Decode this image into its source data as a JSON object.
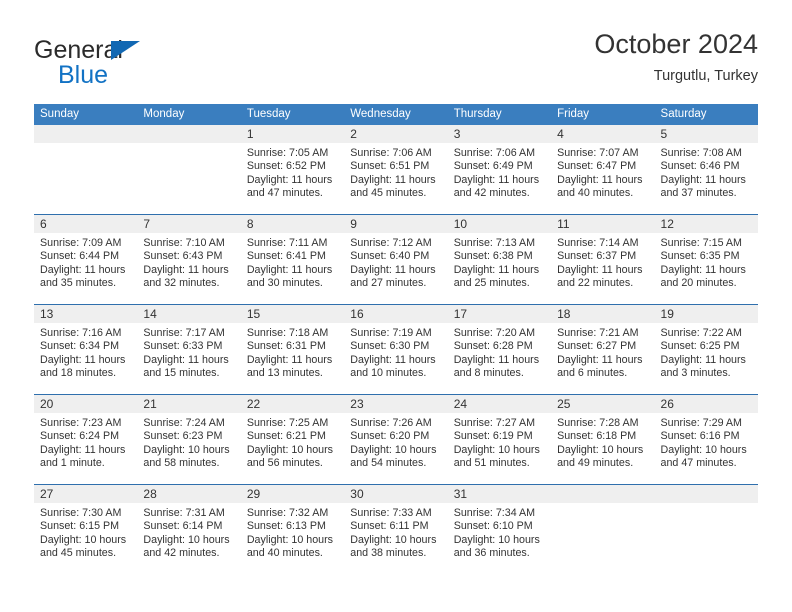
{
  "brand": {
    "name_top": "General",
    "name_bottom": "Blue"
  },
  "header": {
    "title": "October 2024",
    "subtitle": "Turgutlu, Turkey"
  },
  "colors": {
    "header_blue": "#3a7ebf",
    "divider_blue": "#2f6fad",
    "daynum_gray": "#efefef",
    "logo_blue": "#1272c4",
    "text": "#333333"
  },
  "calendar": {
    "weekday_headers": [
      "Sunday",
      "Monday",
      "Tuesday",
      "Wednesday",
      "Thursday",
      "Friday",
      "Saturday"
    ],
    "weeks": [
      [
        {
          "day": "",
          "sunrise": "",
          "sunset": "",
          "daylight": "",
          "empty": true
        },
        {
          "day": "",
          "sunrise": "",
          "sunset": "",
          "daylight": "",
          "empty": true
        },
        {
          "day": "1",
          "sunrise": "Sunrise: 7:05 AM",
          "sunset": "Sunset: 6:52 PM",
          "daylight": "Daylight: 11 hours and 47 minutes."
        },
        {
          "day": "2",
          "sunrise": "Sunrise: 7:06 AM",
          "sunset": "Sunset: 6:51 PM",
          "daylight": "Daylight: 11 hours and 45 minutes."
        },
        {
          "day": "3",
          "sunrise": "Sunrise: 7:06 AM",
          "sunset": "Sunset: 6:49 PM",
          "daylight": "Daylight: 11 hours and 42 minutes."
        },
        {
          "day": "4",
          "sunrise": "Sunrise: 7:07 AM",
          "sunset": "Sunset: 6:47 PM",
          "daylight": "Daylight: 11 hours and 40 minutes."
        },
        {
          "day": "5",
          "sunrise": "Sunrise: 7:08 AM",
          "sunset": "Sunset: 6:46 PM",
          "daylight": "Daylight: 11 hours and 37 minutes."
        }
      ],
      [
        {
          "day": "6",
          "sunrise": "Sunrise: 7:09 AM",
          "sunset": "Sunset: 6:44 PM",
          "daylight": "Daylight: 11 hours and 35 minutes."
        },
        {
          "day": "7",
          "sunrise": "Sunrise: 7:10 AM",
          "sunset": "Sunset: 6:43 PM",
          "daylight": "Daylight: 11 hours and 32 minutes."
        },
        {
          "day": "8",
          "sunrise": "Sunrise: 7:11 AM",
          "sunset": "Sunset: 6:41 PM",
          "daylight": "Daylight: 11 hours and 30 minutes."
        },
        {
          "day": "9",
          "sunrise": "Sunrise: 7:12 AM",
          "sunset": "Sunset: 6:40 PM",
          "daylight": "Daylight: 11 hours and 27 minutes."
        },
        {
          "day": "10",
          "sunrise": "Sunrise: 7:13 AM",
          "sunset": "Sunset: 6:38 PM",
          "daylight": "Daylight: 11 hours and 25 minutes."
        },
        {
          "day": "11",
          "sunrise": "Sunrise: 7:14 AM",
          "sunset": "Sunset: 6:37 PM",
          "daylight": "Daylight: 11 hours and 22 minutes."
        },
        {
          "day": "12",
          "sunrise": "Sunrise: 7:15 AM",
          "sunset": "Sunset: 6:35 PM",
          "daylight": "Daylight: 11 hours and 20 minutes."
        }
      ],
      [
        {
          "day": "13",
          "sunrise": "Sunrise: 7:16 AM",
          "sunset": "Sunset: 6:34 PM",
          "daylight": "Daylight: 11 hours and 18 minutes."
        },
        {
          "day": "14",
          "sunrise": "Sunrise: 7:17 AM",
          "sunset": "Sunset: 6:33 PM",
          "daylight": "Daylight: 11 hours and 15 minutes."
        },
        {
          "day": "15",
          "sunrise": "Sunrise: 7:18 AM",
          "sunset": "Sunset: 6:31 PM",
          "daylight": "Daylight: 11 hours and 13 minutes."
        },
        {
          "day": "16",
          "sunrise": "Sunrise: 7:19 AM",
          "sunset": "Sunset: 6:30 PM",
          "daylight": "Daylight: 11 hours and 10 minutes."
        },
        {
          "day": "17",
          "sunrise": "Sunrise: 7:20 AM",
          "sunset": "Sunset: 6:28 PM",
          "daylight": "Daylight: 11 hours and 8 minutes."
        },
        {
          "day": "18",
          "sunrise": "Sunrise: 7:21 AM",
          "sunset": "Sunset: 6:27 PM",
          "daylight": "Daylight: 11 hours and 6 minutes."
        },
        {
          "day": "19",
          "sunrise": "Sunrise: 7:22 AM",
          "sunset": "Sunset: 6:25 PM",
          "daylight": "Daylight: 11 hours and 3 minutes."
        }
      ],
      [
        {
          "day": "20",
          "sunrise": "Sunrise: 7:23 AM",
          "sunset": "Sunset: 6:24 PM",
          "daylight": "Daylight: 11 hours and 1 minute."
        },
        {
          "day": "21",
          "sunrise": "Sunrise: 7:24 AM",
          "sunset": "Sunset: 6:23 PM",
          "daylight": "Daylight: 10 hours and 58 minutes."
        },
        {
          "day": "22",
          "sunrise": "Sunrise: 7:25 AM",
          "sunset": "Sunset: 6:21 PM",
          "daylight": "Daylight: 10 hours and 56 minutes."
        },
        {
          "day": "23",
          "sunrise": "Sunrise: 7:26 AM",
          "sunset": "Sunset: 6:20 PM",
          "daylight": "Daylight: 10 hours and 54 minutes."
        },
        {
          "day": "24",
          "sunrise": "Sunrise: 7:27 AM",
          "sunset": "Sunset: 6:19 PM",
          "daylight": "Daylight: 10 hours and 51 minutes."
        },
        {
          "day": "25",
          "sunrise": "Sunrise: 7:28 AM",
          "sunset": "Sunset: 6:18 PM",
          "daylight": "Daylight: 10 hours and 49 minutes."
        },
        {
          "day": "26",
          "sunrise": "Sunrise: 7:29 AM",
          "sunset": "Sunset: 6:16 PM",
          "daylight": "Daylight: 10 hours and 47 minutes."
        }
      ],
      [
        {
          "day": "27",
          "sunrise": "Sunrise: 7:30 AM",
          "sunset": "Sunset: 6:15 PM",
          "daylight": "Daylight: 10 hours and 45 minutes."
        },
        {
          "day": "28",
          "sunrise": "Sunrise: 7:31 AM",
          "sunset": "Sunset: 6:14 PM",
          "daylight": "Daylight: 10 hours and 42 minutes."
        },
        {
          "day": "29",
          "sunrise": "Sunrise: 7:32 AM",
          "sunset": "Sunset: 6:13 PM",
          "daylight": "Daylight: 10 hours and 40 minutes."
        },
        {
          "day": "30",
          "sunrise": "Sunrise: 7:33 AM",
          "sunset": "Sunset: 6:11 PM",
          "daylight": "Daylight: 10 hours and 38 minutes."
        },
        {
          "day": "31",
          "sunrise": "Sunrise: 7:34 AM",
          "sunset": "Sunset: 6:10 PM",
          "daylight": "Daylight: 10 hours and 36 minutes."
        },
        {
          "day": "",
          "sunrise": "",
          "sunset": "",
          "daylight": "",
          "empty": true
        },
        {
          "day": "",
          "sunrise": "",
          "sunset": "",
          "daylight": "",
          "empty": true
        }
      ]
    ]
  }
}
